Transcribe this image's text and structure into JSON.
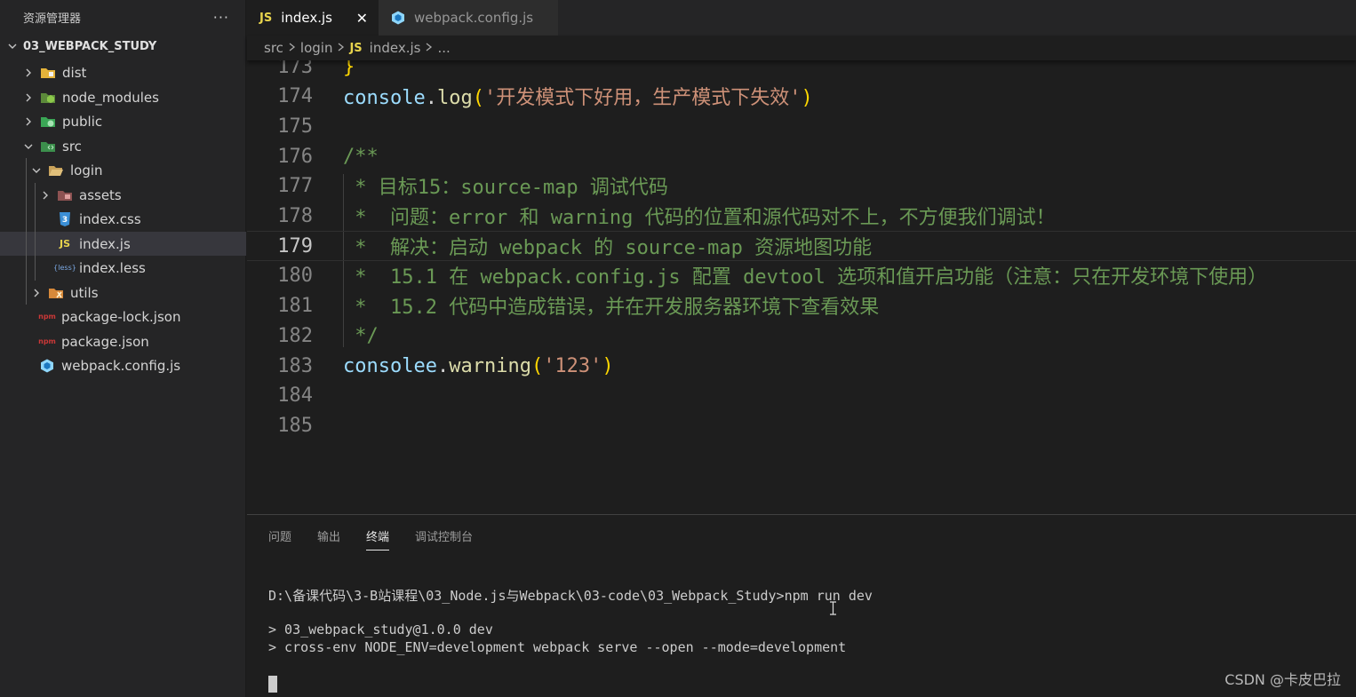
{
  "sidebar": {
    "title": "资源管理器",
    "more": "···",
    "project": "03_WEBPACK_STUDY",
    "items": [
      {
        "label": "dist"
      },
      {
        "label": "node_modules"
      },
      {
        "label": "public"
      },
      {
        "label": "src"
      },
      {
        "label": "login"
      },
      {
        "label": "assets"
      },
      {
        "label": "index.css"
      },
      {
        "label": "index.js"
      },
      {
        "label": "index.less"
      },
      {
        "label": "utils"
      },
      {
        "label": "package-lock.json"
      },
      {
        "label": "package.json"
      },
      {
        "label": "webpack.config.js"
      }
    ],
    "icon_texts": {
      "js": "JS",
      "less": "{less}",
      "npm": "npm",
      "css": "3"
    }
  },
  "tabs": [
    {
      "label": "index.js",
      "badge": "JS",
      "close": "✕"
    },
    {
      "label": "webpack.config.js"
    }
  ],
  "breadcrumb": {
    "parts": [
      "src",
      "login",
      "index.js",
      "..."
    ],
    "badge": "JS"
  },
  "editor": {
    "lines": [
      {
        "num": "173",
        "text": "}"
      },
      {
        "num": "174",
        "text": "console.log('开发模式下好用，生产模式下失效')"
      },
      {
        "num": "175",
        "text": ""
      },
      {
        "num": "176",
        "text": "/**"
      },
      {
        "num": "177",
        "text": " * 目标15：source-map 调试代码"
      },
      {
        "num": "178",
        "text": " *  问题：error 和 warning 代码的位置和源代码对不上，不方便我们调试！"
      },
      {
        "num": "179",
        "text": " *  解决：启动 webpack 的 source-map 资源地图功能"
      },
      {
        "num": "180",
        "text": " *  15.1 在 webpack.config.js 配置 devtool 选项和值开启功能（注意：只在开发环境下使用）"
      },
      {
        "num": "181",
        "text": " *  15.2 代码中造成错误，并在开发服务器环境下查看效果"
      },
      {
        "num": "182",
        "text": " */"
      },
      {
        "num": "183",
        "text": "consolee.warning('123')"
      },
      {
        "num": "184",
        "text": ""
      },
      {
        "num": "185",
        "text": ""
      }
    ],
    "tokens": {
      "l174": {
        "obj": "console",
        "dot": ".",
        "fn": "log",
        "open": "(",
        "str": "'开发模式下好用，生产模式下失效'",
        "close": ")"
      },
      "l183": {
        "obj": "consolee",
        "dot": ".",
        "fn": "warning",
        "open": "(",
        "str": "'123'",
        "close": ")"
      }
    }
  },
  "panel": {
    "tabs": [
      "问题",
      "输出",
      "终端",
      "调试控制台"
    ],
    "active_tab": "终端",
    "terminal": [
      "D:\\备课代码\\3-B站课程\\03_Node.js与Webpack\\03-code\\03_Webpack_Study>npm run dev",
      "> 03_webpack_study@1.0.0 dev",
      "> cross-env NODE_ENV=development webpack serve --open --mode=development"
    ]
  },
  "watermark": "CSDN @卡皮巴拉",
  "colors": {
    "sidebar_bg": "#252526",
    "editor_bg": "#1e1e1e",
    "comment": "#6a9955",
    "string": "#ce9178",
    "variable": "#9cdcfe",
    "function": "#dcdcaa",
    "bracket": "#ffd700",
    "js_badge": "#e8d44d"
  }
}
